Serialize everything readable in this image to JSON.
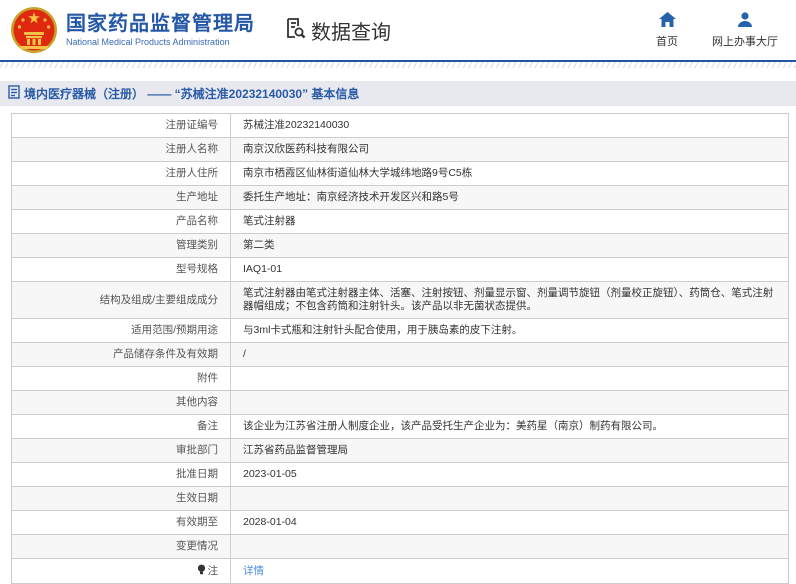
{
  "header": {
    "agency_title": "国家药品监督管理局",
    "agency_subtitle": "National Medical Products Administration",
    "section_label": "数据查询",
    "nav_home": "首页",
    "nav_hall": "网上办事大厅"
  },
  "breadcrumb": {
    "title": "境内医疗器械（注册） —— “苏械注准20232140030” 基本信息"
  },
  "detail_table": {
    "rows": [
      {
        "label": "注册证编号",
        "value": "苏械注准20232140030"
      },
      {
        "label": "注册人名称",
        "value": "南京汉欣医药科技有限公司"
      },
      {
        "label": "注册人住所",
        "value": "南京市栖霞区仙林街道仙林大学城纬地路9号C5栋"
      },
      {
        "label": "生产地址",
        "value": "委托生产地址：南京经济技术开发区兴和路5号"
      },
      {
        "label": "产品名称",
        "value": "笔式注射器"
      },
      {
        "label": "管理类别",
        "value": "第二类"
      },
      {
        "label": "型号规格",
        "value": "IAQ1-01"
      },
      {
        "label": "结构及组成/主要组成成分",
        "value": "笔式注射器由笔式注射器主体、活塞、注射按钮、剂量显示窗、剂量调节旋钮（剂量校正旋钮）、药筒仓、笔式注射器帽组成；不包含药筒和注射针头。该产品以非无菌状态提供。"
      },
      {
        "label": "适用范围/预期用途",
        "value": "与3ml卡式瓶和注射针头配合使用，用于胰岛素的皮下注射。"
      },
      {
        "label": "产品储存条件及有效期",
        "value": "/"
      },
      {
        "label": "附件",
        "value": ""
      },
      {
        "label": "其他内容",
        "value": ""
      },
      {
        "label": "备注",
        "value": "该企业为江苏省注册人制度企业，该产品受托生产企业为：美药星（南京）制药有限公司。"
      },
      {
        "label": "审批部门",
        "value": "江苏省药品监督管理局"
      },
      {
        "label": "批准日期",
        "value": "2023-01-05"
      },
      {
        "label": "生效日期",
        "value": ""
      },
      {
        "label": "有效期至",
        "value": "2028-01-04"
      },
      {
        "label": "变更情况",
        "value": ""
      },
      {
        "label": "注",
        "value": "详情",
        "link": true,
        "icon": "bulb-icon"
      }
    ]
  },
  "colors": {
    "primary_blue": "#2457a5",
    "nav_icon_blue": "#2563ad",
    "header_border": "#1d57a6",
    "breadcrumb_bg": "#e7e9ef",
    "link_blue": "#4a90e2",
    "row_alt_bg": "#f7f7f7",
    "table_border": "#cccccc"
  }
}
